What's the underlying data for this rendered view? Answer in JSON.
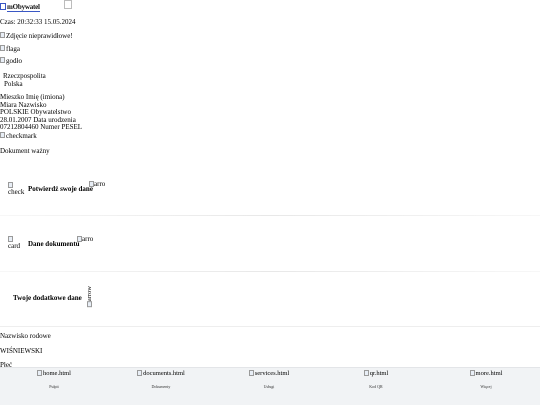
{
  "header": {
    "logo_text": "mObywatel",
    "logo_image_alt": ""
  },
  "time_line": "Czas: 20:32:33 15.05.2024",
  "photo_alt": "Zdjęcie nieprawidłowe!",
  "flag_alt": "flaga",
  "emblem_alt": "godło",
  "country": {
    "line1": "Rzeczpospolita",
    "line2": "Polska"
  },
  "person": {
    "first_names_line": "Mieszko Imię (imiona)",
    "surname_line": "Miara Nazwisko",
    "citizenship_line": "POLSKIE Obywatelstwo",
    "birth_date_line": "28.01.2007 Data urodzenia",
    "pesel_line": "07212804460 Numer PESEL"
  },
  "checkmark_alt": "checkmark",
  "document_status": "Dokument ważny",
  "cards": [
    {
      "icon_alt": "check",
      "title": "Potwierdź swoje dane",
      "arrow_alt": "arro"
    },
    {
      "icon_alt": "card",
      "title": "Dane dokumentu",
      "arrow_alt": "arro"
    },
    {
      "title": "Twoje dodatkowe dane",
      "arrow_alt": "arrow"
    }
  ],
  "details": {
    "maiden_name_label": "Nazwisko rodowe",
    "maiden_name_value": "WIŚNIEWSKI",
    "sex_label": "Płeć"
  },
  "bottom_nav": [
    {
      "href_alt": "home.html",
      "label": "Pulpit"
    },
    {
      "href_alt": "documents.html",
      "label": "Dokumenty"
    },
    {
      "href_alt": "services.html",
      "label": "Usługi"
    },
    {
      "href_alt": "qr.html",
      "label": "Kod QR"
    },
    {
      "href_alt": "more.html",
      "label": "Więcej"
    }
  ]
}
